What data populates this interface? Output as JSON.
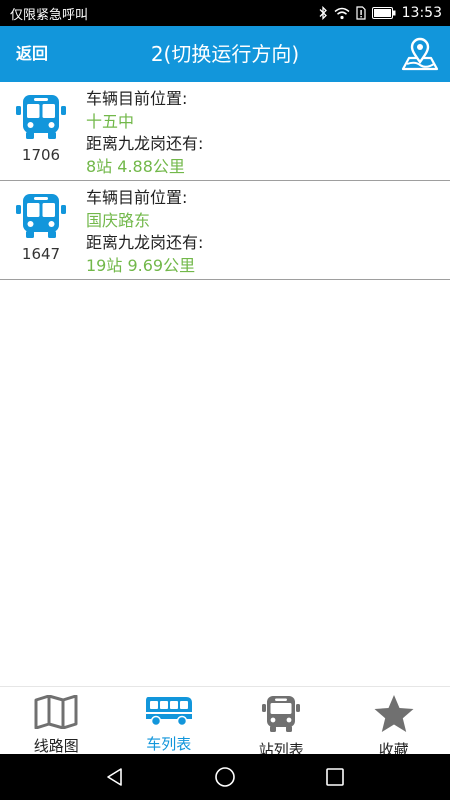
{
  "status_bar": {
    "carrier": "仅限紧急呼叫",
    "time": "13:53"
  },
  "header": {
    "back_label": "返回",
    "title": "2(切换运行方向)",
    "map_icon": "map-pin-icon"
  },
  "buses": [
    {
      "id": "1706",
      "position_label": "车辆目前位置:",
      "position_value": "十五中",
      "distance_label": "距离九龙岗还有:",
      "distance_value": "8站  4.88公里"
    },
    {
      "id": "1647",
      "position_label": "车辆目前位置:",
      "position_value": "国庆路东",
      "distance_label": "距离九龙岗还有:",
      "distance_value": "19站  9.69公里"
    }
  ],
  "tabs": [
    {
      "label": "线路图",
      "icon": "map-icon",
      "active": false
    },
    {
      "label": "车列表",
      "icon": "bus-side-icon",
      "active": true
    },
    {
      "label": "站列表",
      "icon": "bus-front-icon",
      "active": false
    },
    {
      "label": "收藏",
      "icon": "star-icon",
      "active": false
    }
  ],
  "colors": {
    "primary": "#1296db",
    "value_green": "#72b84a",
    "inactive_icon": "#707070"
  }
}
